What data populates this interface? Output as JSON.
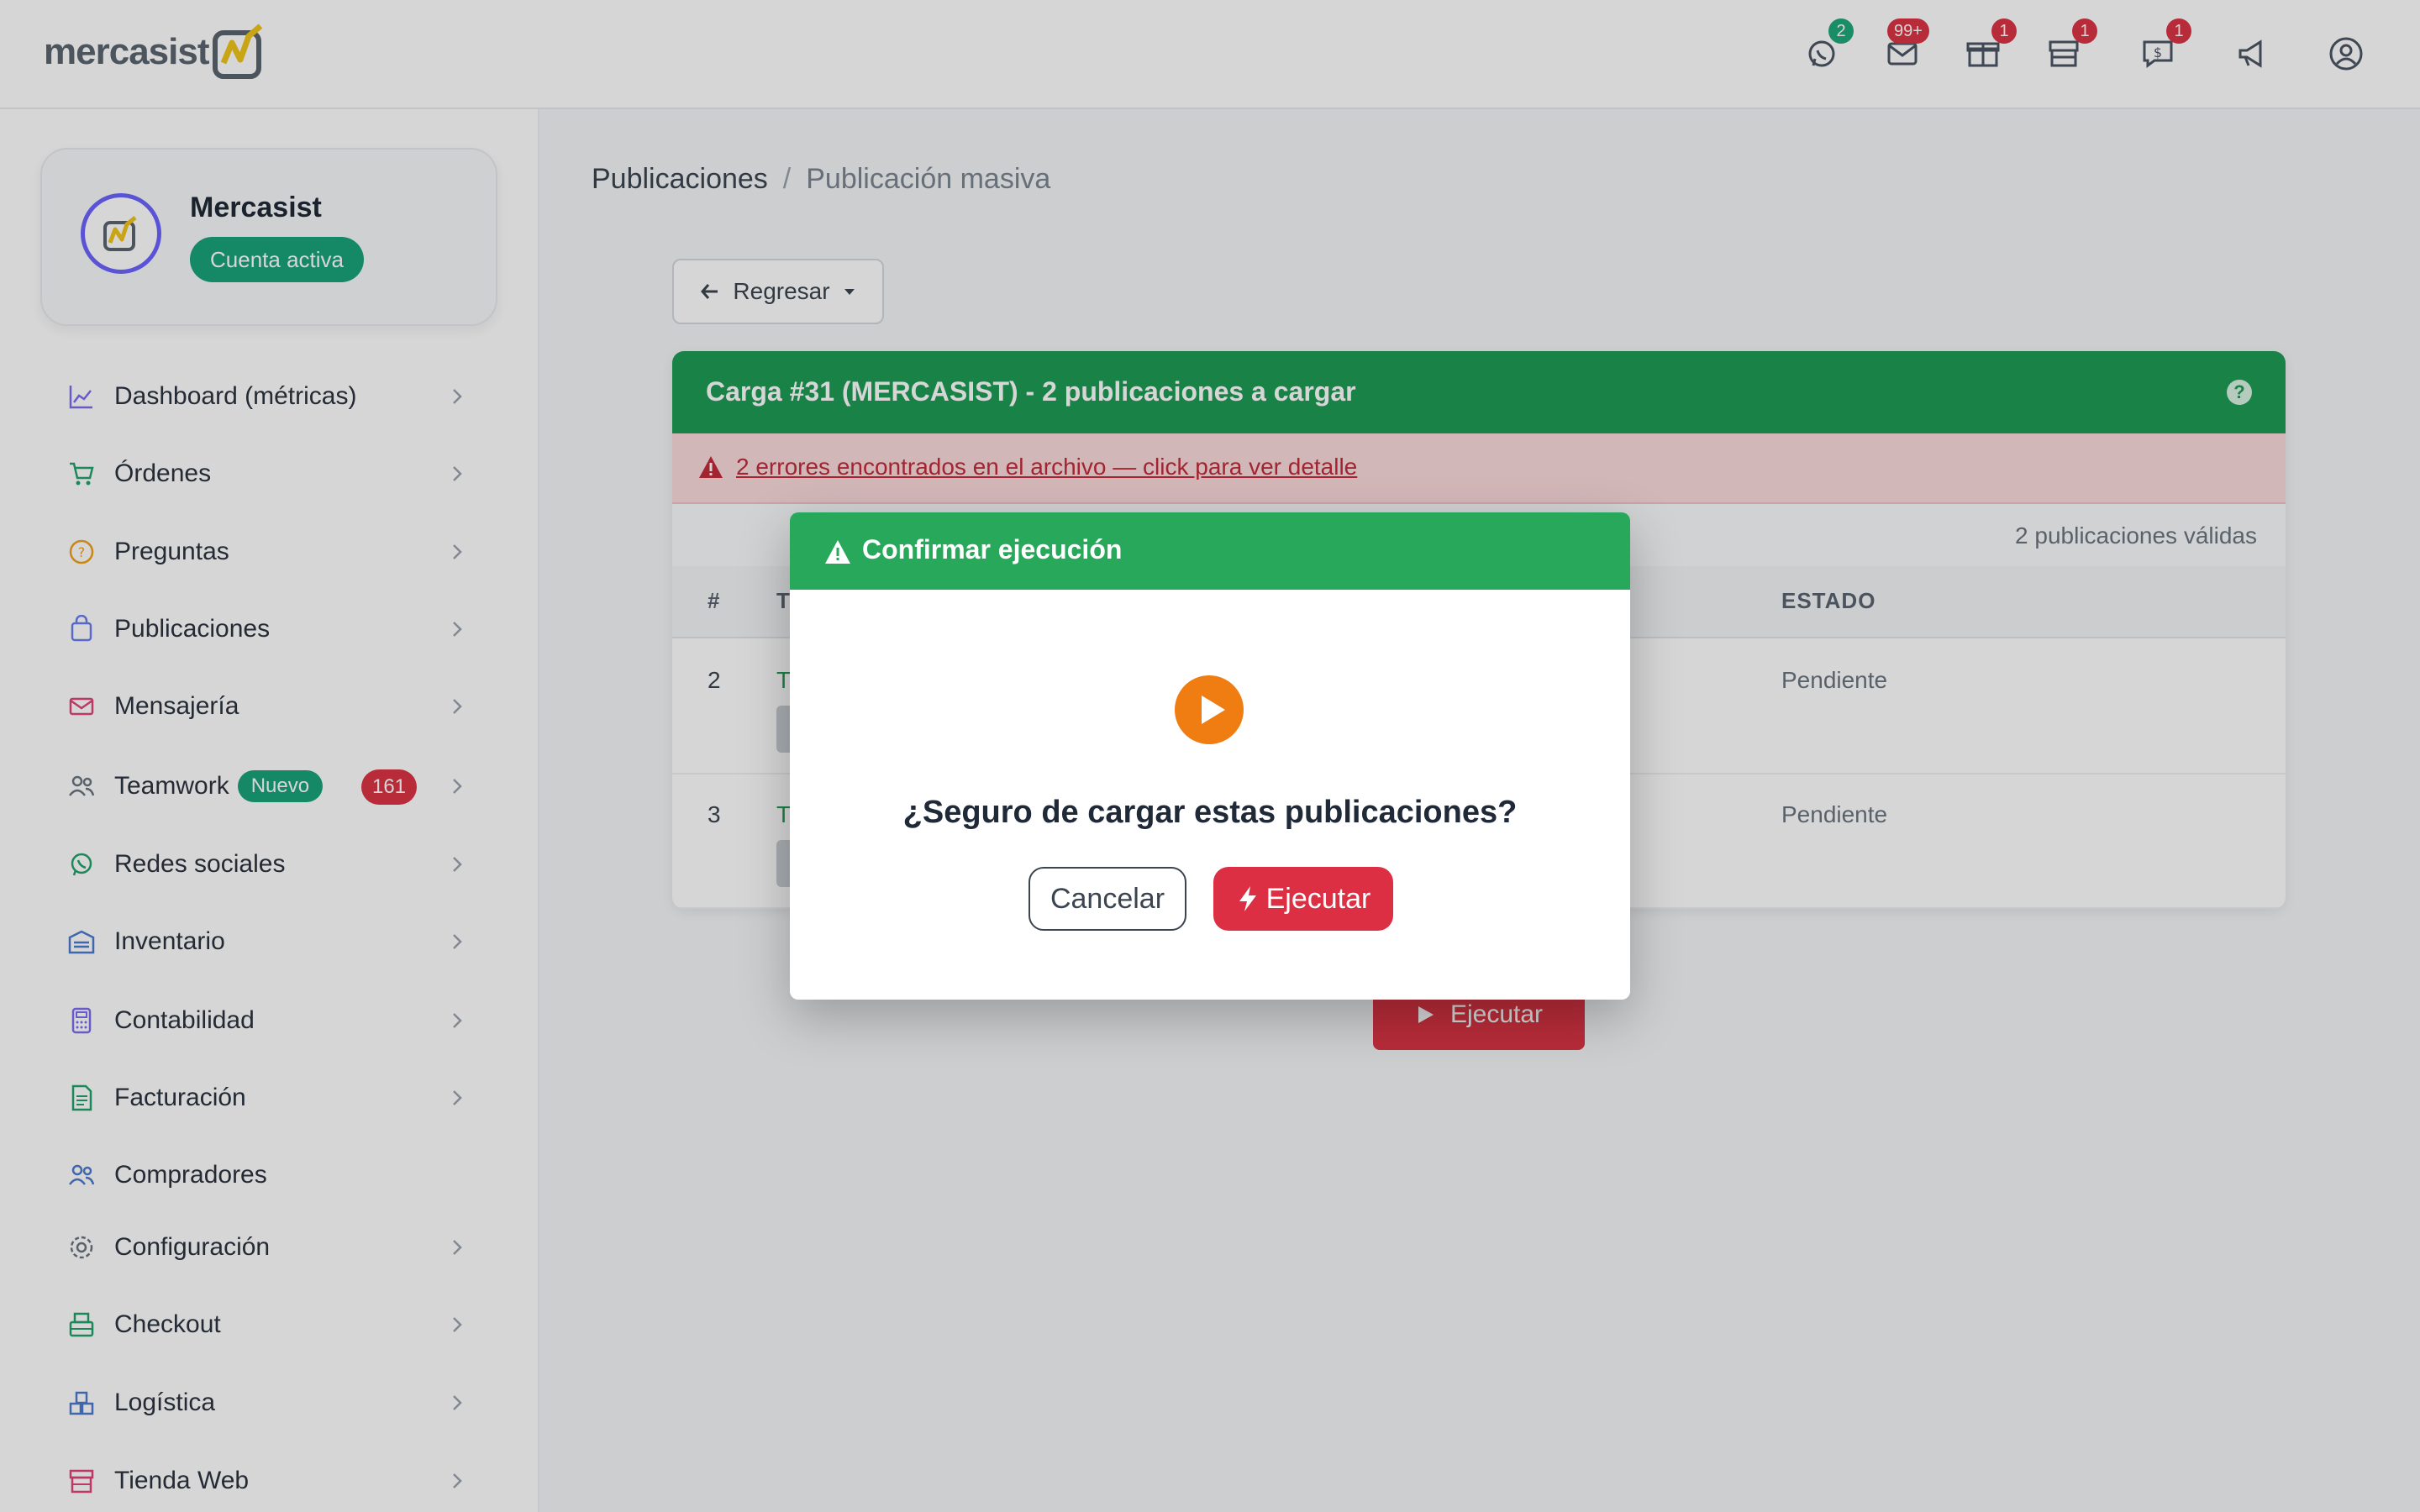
{
  "brand": {
    "name": "mercasist"
  },
  "top_badges": {
    "whatsapp": "2",
    "mail": "99+",
    "package": "1",
    "store": "1",
    "sales_chat": "1"
  },
  "profile": {
    "name": "Mercasist",
    "status": "Cuenta activa"
  },
  "sidebar": {
    "items": [
      {
        "label": "Dashboard (métricas)",
        "icon": "chart-line-icon"
      },
      {
        "label": "Órdenes",
        "icon": "cart-icon"
      },
      {
        "label": "Preguntas",
        "icon": "question-circle-icon"
      },
      {
        "label": "Publicaciones",
        "icon": "bag-icon"
      },
      {
        "label": "Mensajería",
        "icon": "mail-icon"
      },
      {
        "label": "Teamwork",
        "icon": "users-icon",
        "new_badge": "Nuevo",
        "count": "161"
      },
      {
        "label": "Redes sociales",
        "icon": "whatsapp-icon"
      },
      {
        "label": "Inventario",
        "icon": "warehouse-icon"
      },
      {
        "label": "Contabilidad",
        "icon": "calculator-icon"
      },
      {
        "label": "Facturación",
        "icon": "invoice-icon"
      },
      {
        "label": "Compradores",
        "icon": "buyers-icon"
      },
      {
        "label": "Configuración",
        "icon": "gear-icon"
      },
      {
        "label": "Checkout",
        "icon": "checkout-icon"
      },
      {
        "label": "Logística",
        "icon": "boxes-icon"
      },
      {
        "label": "Tienda Web",
        "icon": "store-icon"
      }
    ]
  },
  "breadcrumb": {
    "parent": "Publicaciones",
    "separator": "/",
    "current": "Publicación masiva"
  },
  "back_button": {
    "label": "Regresar"
  },
  "card": {
    "title": "Carga #31 (MERCASIST) - 2 publicaciones a cargar",
    "help": "?",
    "error_link": "2 errores encontrados en el archivo — click para ver detalle",
    "valid_count": "2 publicaciones válidas",
    "columns": [
      "#",
      "T",
      "ESTADO"
    ],
    "rows": [
      {
        "num": "2",
        "title": "T",
        "status": "Pendiente"
      },
      {
        "num": "3",
        "title": "T",
        "status": "Pendiente"
      }
    ],
    "execute_label": "Ejecutar"
  },
  "modal": {
    "title": "Confirmar ejecución",
    "question": "¿Seguro de cargar estas publicaciones?",
    "cancel": "Cancelar",
    "execute": "Ejecutar"
  },
  "colors": {
    "primary_green": "#1e9b54",
    "modal_green": "#27a85a",
    "danger_red": "#dc2f43",
    "accent_orange": "#ef7d12",
    "teal_badge": "#1aa37a"
  }
}
